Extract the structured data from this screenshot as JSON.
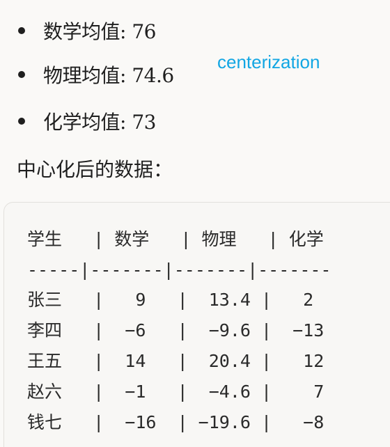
{
  "means": [
    {
      "label": "数学均值: 76"
    },
    {
      "label": "物理均值: 74.6"
    },
    {
      "label": "化学均值: 73"
    }
  ],
  "annotation": "centerization",
  "heading": "中心化后的数据：",
  "table": {
    "header": "学生   | 数学   | 物理   | 化学",
    "separator": "-----|-------|-------|-------",
    "rows": [
      "张三   |   9   |  13.4 |   2",
      "李四   |  −6   |  −9.6 |  −13",
      "王五   |  14   |  20.4 |   12",
      "赵六   |  −1   |  −4.6 |    7",
      "钱七   |  −16  | −19.6 |   −8"
    ]
  }
}
